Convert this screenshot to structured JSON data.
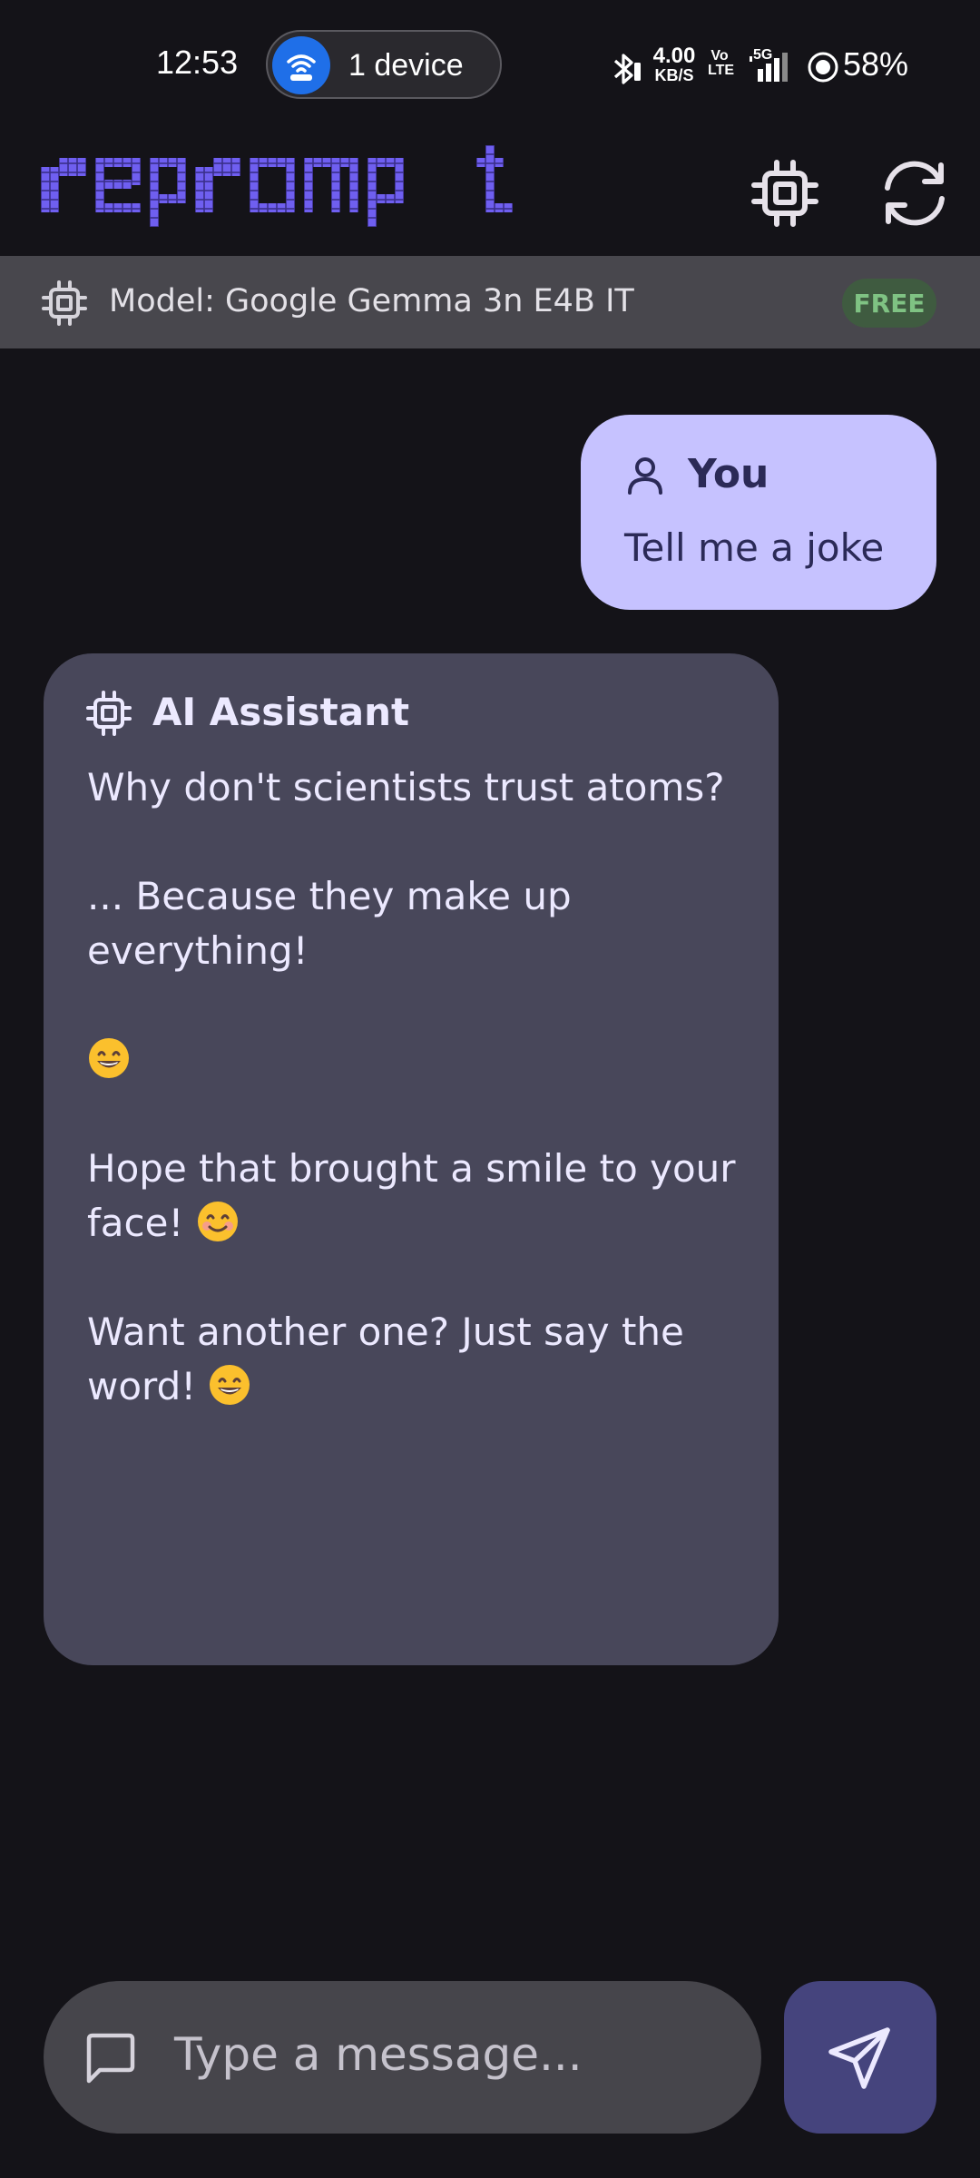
{
  "status_bar": {
    "time": "12:53",
    "hotspot_label": "1 device",
    "net_speed_value": "4.00",
    "net_speed_unit": "KB/S",
    "volte_top": "Vo",
    "volte_bottom": "LTE",
    "network": "5G",
    "battery": "58%"
  },
  "app_bar": {
    "logo_text": "reprompt",
    "icons": [
      "chip-icon",
      "refresh-icon"
    ],
    "accent_color": "#6f5ff0"
  },
  "model_bar": {
    "label": "Model: Google Gemma 3n E4B IT",
    "badge": "FREE"
  },
  "chat": {
    "user": {
      "name": "You",
      "text": "Tell me a joke"
    },
    "assistant": {
      "name": "AI Assistant",
      "paragraphs": [
        "Why don't scientists trust atoms?",
        "... Because they make up everything!",
        "",
        "Hope that brought a smile to your face!",
        "Want another one? Just say the word!"
      ]
    }
  },
  "composer": {
    "placeholder": "Type a message..."
  }
}
